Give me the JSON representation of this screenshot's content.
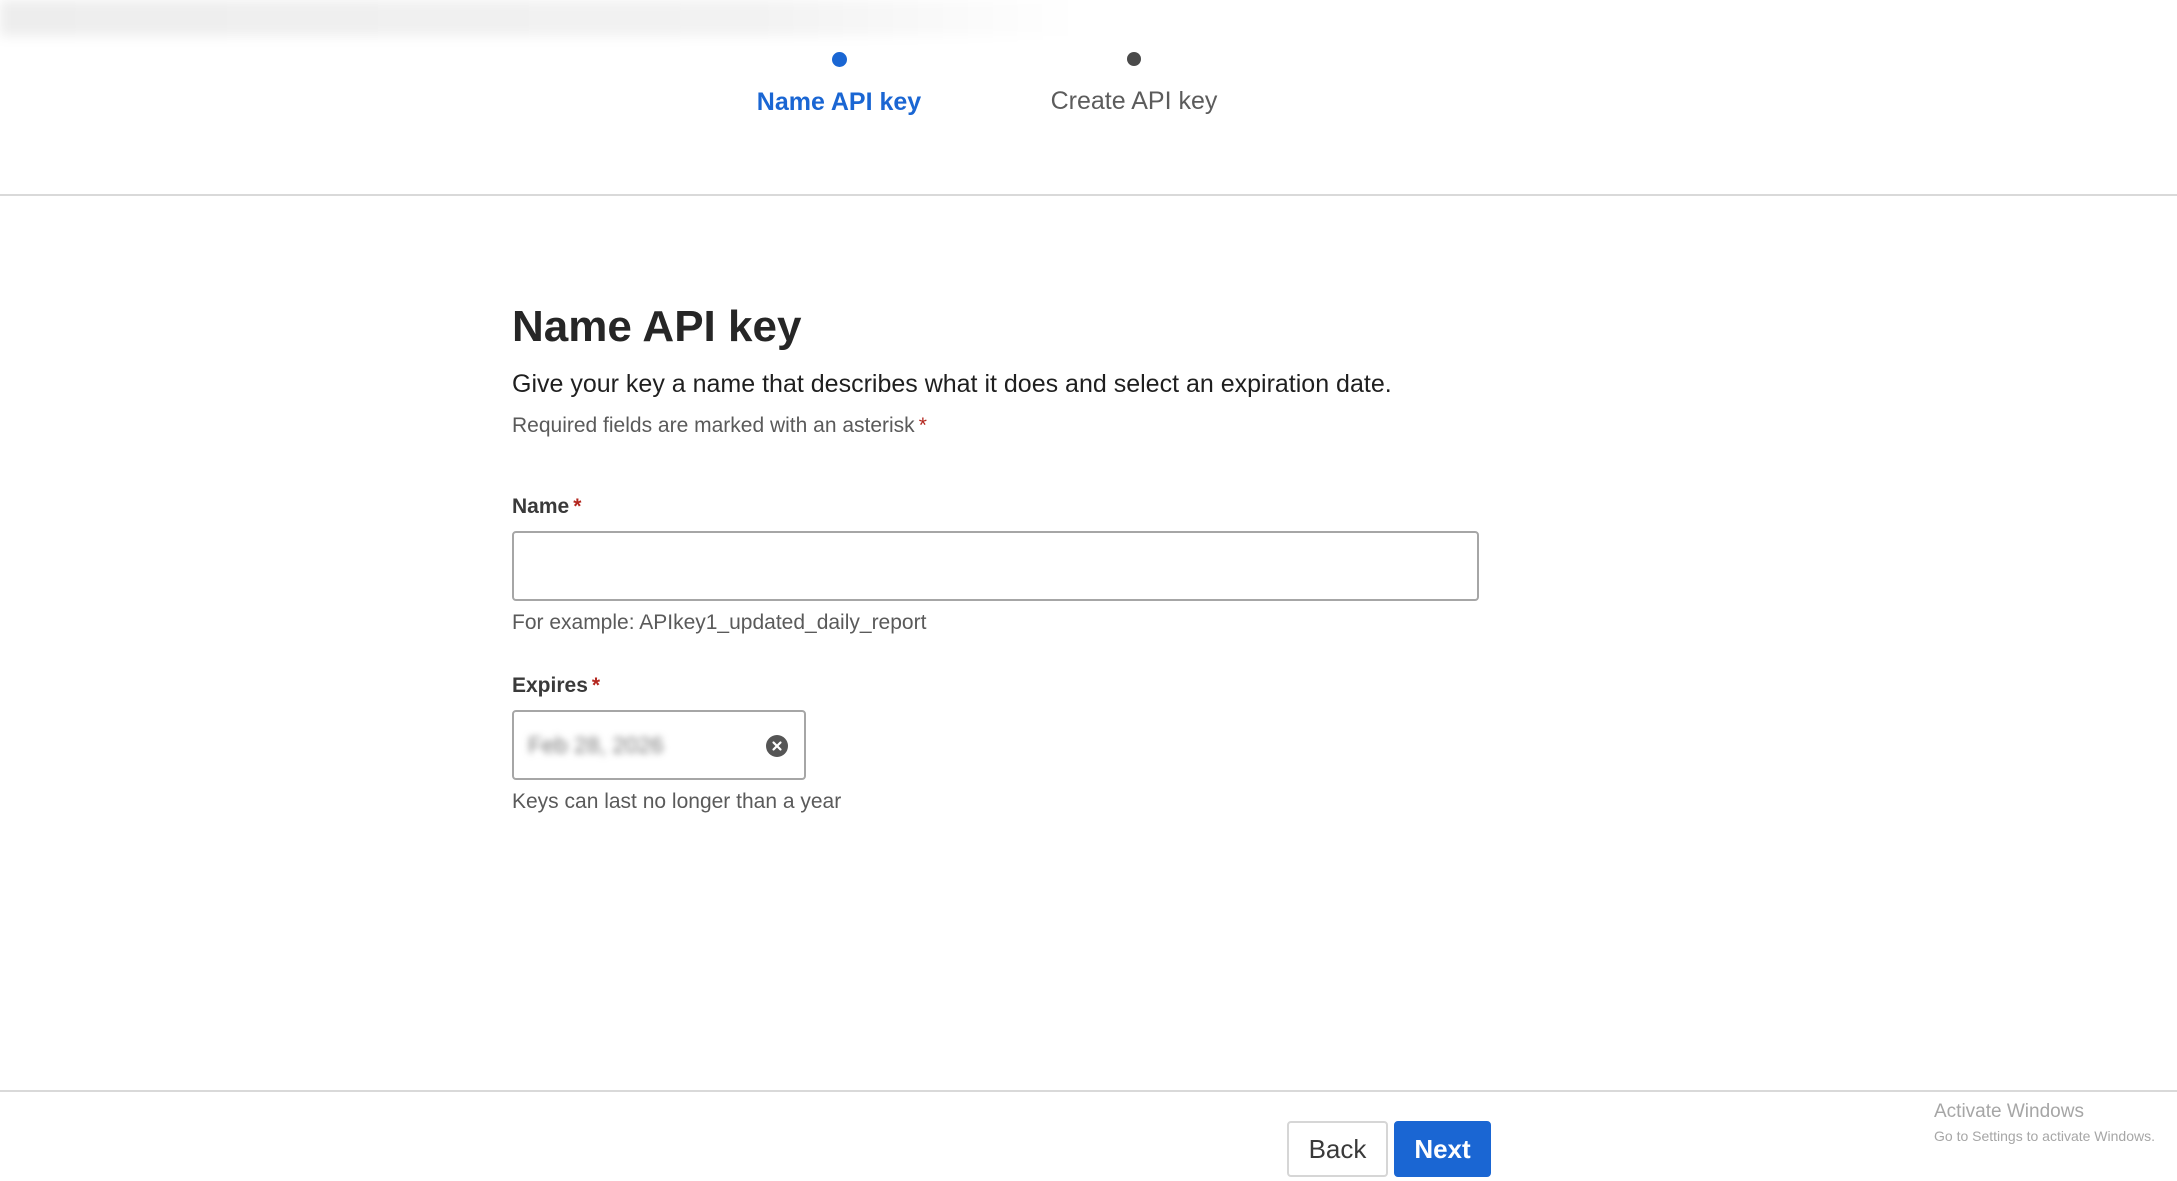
{
  "stepper": {
    "steps": [
      {
        "label": "Name API key",
        "state": "active"
      },
      {
        "label": "Create API key",
        "state": "upcoming"
      }
    ]
  },
  "form": {
    "title": "Name API key",
    "subtitle": "Give your key a name that describes what it does and select an expiration date.",
    "required_note": "Required fields are marked with an asterisk",
    "required_marker": "*",
    "name_field": {
      "label": "Name",
      "value": "",
      "placeholder": "",
      "helper": "For example: APIkey1_updated_daily_report"
    },
    "expires_field": {
      "label": "Expires",
      "value": "Feb 28, 2026",
      "helper": "Keys can last no longer than a year",
      "clear_icon": "clear-circle-icon"
    }
  },
  "footer": {
    "back_label": "Back",
    "next_label": "Next"
  },
  "watermark": {
    "title": "Activate Windows",
    "subtitle": "Go to Settings to activate Windows."
  },
  "colors": {
    "accent": "#1a66d3",
    "required": "#b3261e",
    "border": "#a6a6a6",
    "divider": "#d9d9d9"
  }
}
